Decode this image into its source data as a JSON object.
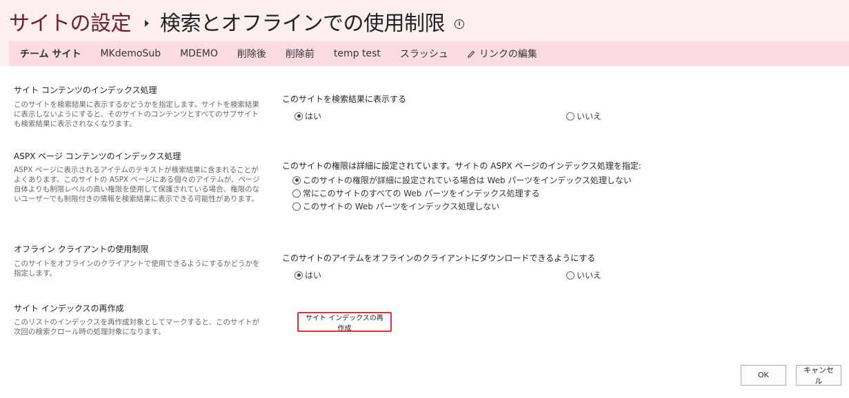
{
  "header": {
    "site_link": "サイトの設定",
    "page_title": "検索とオフラインでの使用制限",
    "info_glyph": "i"
  },
  "nav": {
    "items": [
      "チーム サイト",
      "MKdemoSub",
      "MDEMO",
      "削除後",
      "削除前",
      "temp test",
      "スラッシュ"
    ],
    "edit_links": "リンクの編集"
  },
  "sections": {
    "indexing": {
      "title": "サイト コンテンツのインデックス処理",
      "description": "このサイトを検索結果に表示するかどうかを指定します。サイトを検索結果に表示しないようにすると、そのサイトのコンテンツとすべてのサブサイトも検索結果に表示されなくなります。",
      "field_label": "このサイトを検索結果に表示する",
      "options": [
        "はい",
        "いいえ"
      ],
      "selected": "はい"
    },
    "aspx": {
      "title": "ASPX ページ コンテンツのインデックス処理",
      "description": "ASPX ページに表示されるアイテムのテキストが検索結果に含まれることがよくあります。このサイトの ASPX ページにある個々のアイテムが、ページ自体よりも制限レベルの高い権限を使用して保護されている場合、権限のないユーザーでも制限付きの情報を検索結果に表示できる可能性があります。",
      "field_label": "このサイトの権限は詳細に設定されています。サイトの ASPX ページのインデックス処理を指定:",
      "options": [
        "このサイトの権限が詳細に設定されている場合は Web パーツをインデックス処理しない",
        "常にこのサイトのすべての Web パーツをインデックス処理する",
        "このサイトの Web パーツをインデックス処理しない"
      ],
      "selected": "このサイトの権限が詳細に設定されている場合は Web パーツをインデックス処理しない"
    },
    "offline": {
      "title": "オフライン クライアントの使用制限",
      "description": "このサイトをオフラインのクライアントで使用できるようにするかどうかを指定します。",
      "field_label": "このサイトのアイテムをオフラインのクライアントにダウンロードできるようにする",
      "options": [
        "はい",
        "いいえ"
      ],
      "selected": "はい"
    },
    "reindex": {
      "title": "サイト インデックスの再作成",
      "description": "このリストのインデックスを再作成対象としてマークすると、このサイトが次回の検索クロール時の処理対象になります。",
      "button_label": "サイト インデックスの再作成"
    }
  },
  "footer": {
    "ok_label": "OK",
    "cancel_label": "キャンセル"
  },
  "colors": {
    "header_bg": "#fdeef0",
    "nav_bg": "#fadce2",
    "site_link": "#6e1e2a",
    "highlight_border": "#e03030"
  }
}
